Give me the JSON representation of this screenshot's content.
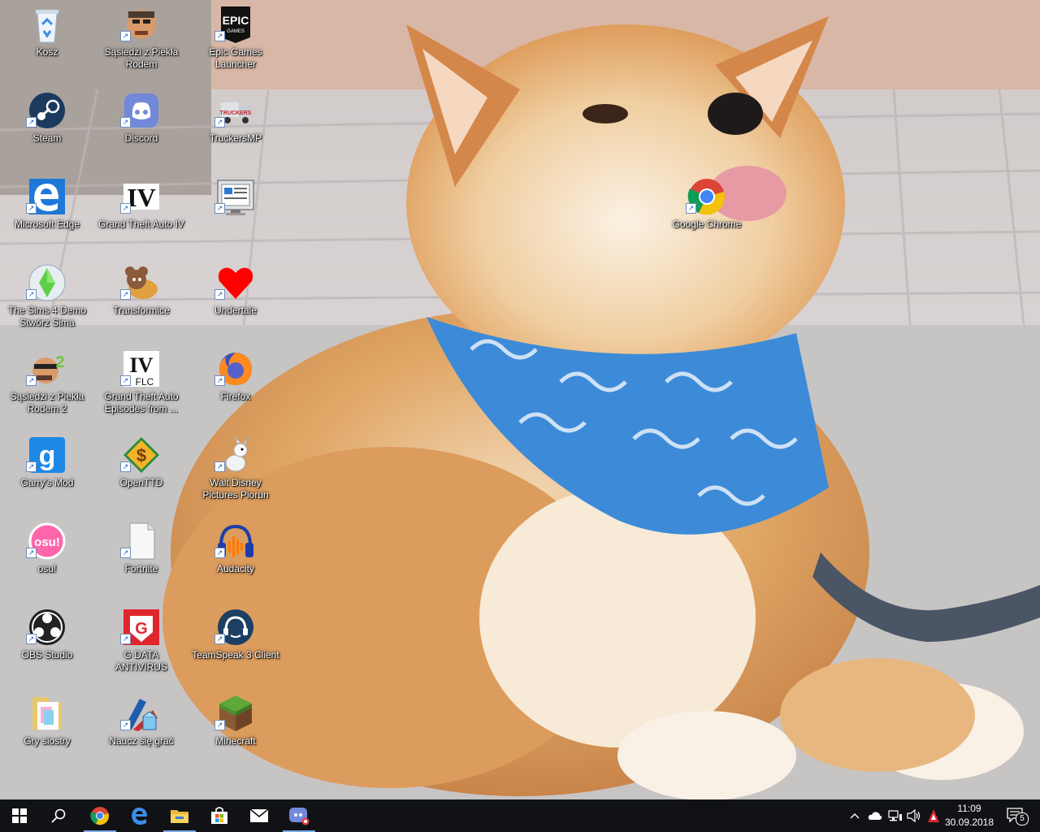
{
  "desktop": {
    "icons": [
      {
        "id": "kosz",
        "label": "Kosz",
        "icon": "recycle-bin-icon"
      },
      {
        "id": "sasiedzi1",
        "label": "Sąsiedzi z Piekła Rodem",
        "icon": "neighbor-game-icon"
      },
      {
        "id": "epic",
        "label": "Epic Games Launcher",
        "icon": "epic-games-icon"
      },
      {
        "id": "steam",
        "label": "Steam",
        "icon": "steam-icon"
      },
      {
        "id": "discord",
        "label": "Discord",
        "icon": "discord-icon"
      },
      {
        "id": "truckersmp",
        "label": "TruckersMP",
        "icon": "truckersmp-icon"
      },
      {
        "id": "edge",
        "label": "Microsoft Edge",
        "icon": "edge-icon"
      },
      {
        "id": "gta4",
        "label": "Grand Theft Auto IV",
        "icon": "gta-iv-icon"
      },
      {
        "id": "monitor",
        "label": "",
        "icon": "monitor-program-icon"
      },
      {
        "id": "chrome",
        "label": "Google Chrome",
        "icon": "chrome-icon"
      },
      {
        "id": "sims4",
        "label": "The Sims 4 Demo Stwórz Sima",
        "icon": "sims-plumbob-icon"
      },
      {
        "id": "transformice",
        "label": "Transformice",
        "icon": "transformice-mouse-icon"
      },
      {
        "id": "undertale",
        "label": "Undertale",
        "icon": "red-heart-icon"
      },
      {
        "id": "sasiedzi2",
        "label": "Sąsiedzi z Piekła Rodem 2",
        "icon": "neighbor-game-2-icon"
      },
      {
        "id": "gtaeflc",
        "label": "Grand Theft Auto Episodes from ...",
        "icon": "gta-eflc-icon"
      },
      {
        "id": "firefox",
        "label": "Firefox",
        "icon": "firefox-icon"
      },
      {
        "id": "garrysmod",
        "label": "Garry's Mod",
        "icon": "garrys-mod-icon"
      },
      {
        "id": "openttd",
        "label": "OpenTTD",
        "icon": "openttd-icon"
      },
      {
        "id": "piorun",
        "label": "Walt Disney Pictures Piorun",
        "icon": "bolt-dog-icon"
      },
      {
        "id": "osu",
        "label": "osu!",
        "icon": "osu-icon"
      },
      {
        "id": "fortnite",
        "label": "Fortnite",
        "icon": "blank-file-icon"
      },
      {
        "id": "audacity",
        "label": "Audacity",
        "icon": "audacity-icon"
      },
      {
        "id": "obs",
        "label": "OBS Studio",
        "icon": "obs-icon"
      },
      {
        "id": "gdata",
        "label": "G DATA ANTIVIRUS",
        "icon": "gdata-icon"
      },
      {
        "id": "teamspeak",
        "label": "TeamSpeak 3 Client",
        "icon": "teamspeak-icon"
      },
      {
        "id": "grysiostry",
        "label": "Gry siostry",
        "icon": "folder-icon"
      },
      {
        "id": "naucz",
        "label": "Naucz się grać",
        "icon": "learn-game-icon"
      },
      {
        "id": "minecraft",
        "label": "Minecraft",
        "icon": "minecraft-grass-block-icon"
      }
    ]
  },
  "taskbar": {
    "start": "windows-start-icon",
    "search": "search-icon",
    "pinned": [
      "chrome-icon",
      "edge-icon",
      "file-explorer-icon",
      "store-icon",
      "mail-icon",
      "discord-icon"
    ],
    "tray": [
      "chevron-up-icon",
      "onedrive-cloud-icon",
      "network-icon",
      "volume-icon",
      "gdata-tray-icon"
    ],
    "time": "11:09",
    "date": "30.09.2018",
    "notifications": "5",
    "accent": "#7aa9e4"
  },
  "wallpaper": "shiba-inu-dog-wallpaper"
}
